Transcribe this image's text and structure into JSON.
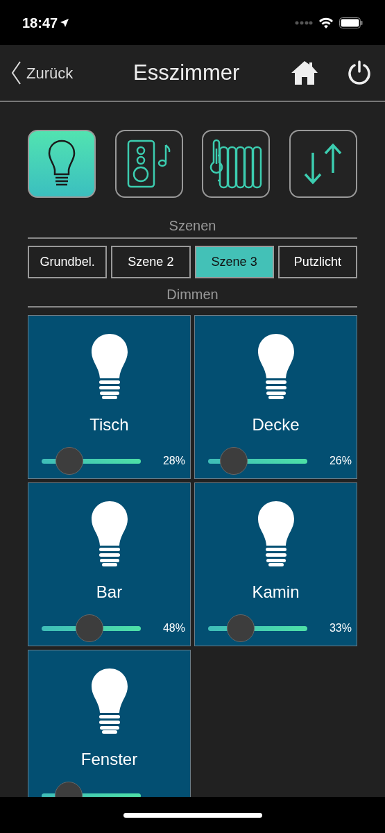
{
  "status_bar": {
    "time": "18:47"
  },
  "nav": {
    "back": "Zurück",
    "title": "Esszimmer"
  },
  "categories": [
    {
      "kind": "light",
      "selected": true
    },
    {
      "kind": "media",
      "selected": false
    },
    {
      "kind": "climate",
      "selected": false
    },
    {
      "kind": "shutter",
      "selected": false
    }
  ],
  "scenes": {
    "heading": "Szenen",
    "items": [
      {
        "label": "Grundbel.",
        "selected": false
      },
      {
        "label": "Szene 2",
        "selected": false
      },
      {
        "label": "Szene 3",
        "selected": true
      },
      {
        "label": "Putzlicht",
        "selected": false
      }
    ]
  },
  "dimmers": {
    "heading": "Dimmen",
    "items": [
      {
        "name": "Tisch",
        "level": 0.28,
        "reading": "28%"
      },
      {
        "name": "Decke",
        "level": 0.26,
        "reading": "26%"
      },
      {
        "name": "Bar",
        "level": 0.48,
        "reading": "48%"
      },
      {
        "name": "Kamin",
        "level": 0.33,
        "reading": "33%"
      },
      {
        "name": "Fenster",
        "level": 0.27
      }
    ]
  }
}
